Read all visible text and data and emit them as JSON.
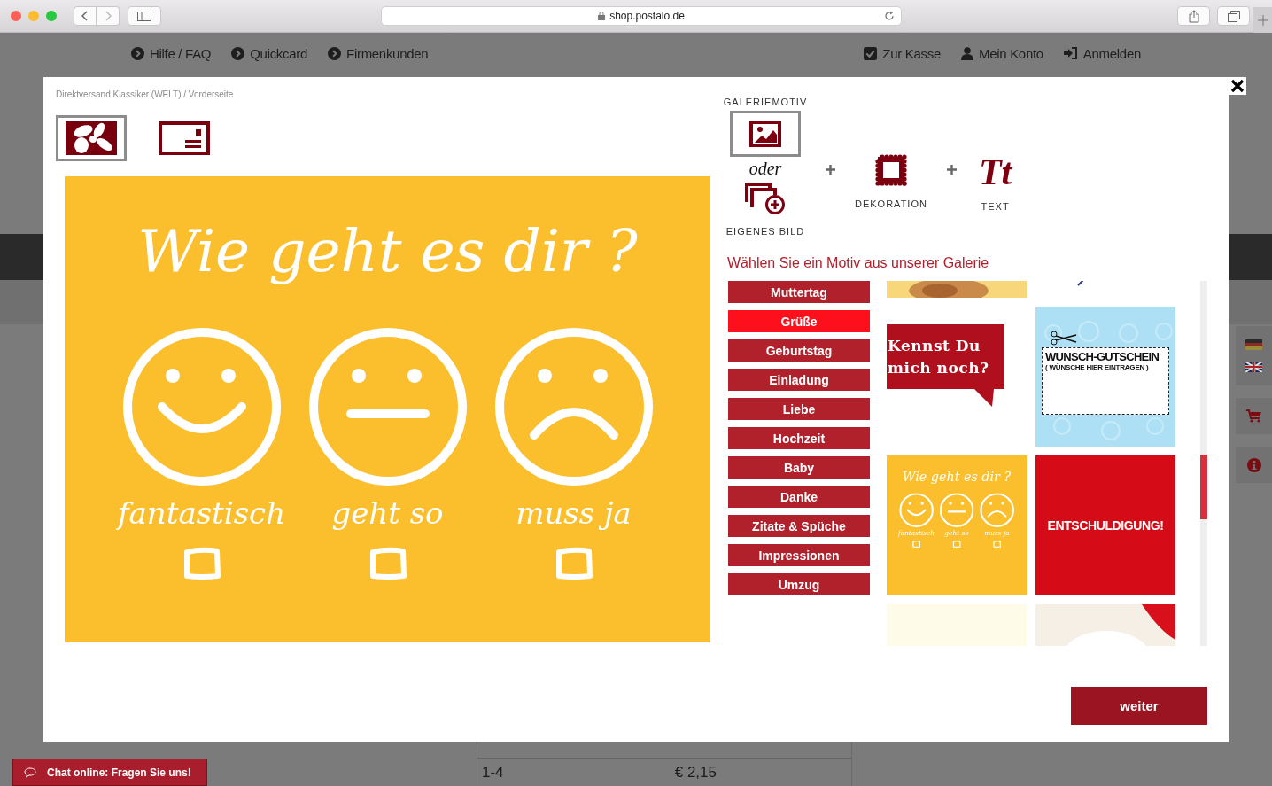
{
  "browser": {
    "url": "shop.postalo.de"
  },
  "top_nav": {
    "left": [
      {
        "label": "Hilfe / FAQ"
      },
      {
        "label": "Quickcard"
      },
      {
        "label": "Firmenkunden"
      }
    ],
    "right": [
      {
        "label": "Zur Kasse",
        "kind": "checkout"
      },
      {
        "label": "Mein Konto",
        "kind": "account"
      },
      {
        "label": "Anmelden",
        "kind": "login"
      }
    ]
  },
  "modal": {
    "breadcrumb": "Direktversand Klassiker (WELT) / Vorderseite",
    "views": [
      {
        "kind": "front",
        "selected": true
      },
      {
        "kind": "back",
        "selected": false
      }
    ],
    "card": {
      "title": "Wie geht es dir ?",
      "options": [
        {
          "label": "fantastisch",
          "kind": "happy"
        },
        {
          "label": "geht so",
          "kind": "neutral"
        },
        {
          "label": "muss ja",
          "kind": "sad"
        }
      ]
    },
    "steps": [
      {
        "label": "GALERIEMOTIV",
        "selected": true
      },
      {
        "label": "EIGENES BILD",
        "selected": false
      },
      {
        "label": "DEKORATION",
        "selected": false
      },
      {
        "label": "TEXT",
        "glyph": "Tt",
        "selected": false
      }
    ],
    "or_label": "oder",
    "gallery_heading": "Wählen Sie ein Motiv aus unserer Galerie",
    "categories": [
      {
        "label": "Muttertag",
        "selected": false
      },
      {
        "label": "Grüße",
        "selected": true
      },
      {
        "label": "Geburtstag",
        "selected": false
      },
      {
        "label": "Einladung",
        "selected": false
      },
      {
        "label": "Liebe",
        "selected": false
      },
      {
        "label": "Hochzeit",
        "selected": false
      },
      {
        "label": "Baby",
        "selected": false
      },
      {
        "label": "Danke",
        "selected": false
      },
      {
        "label": "Zitate & Spüche",
        "selected": false
      },
      {
        "label": "Impressionen",
        "selected": false
      },
      {
        "label": "Umzug",
        "selected": false
      }
    ],
    "gallery": [
      {
        "kind": "picture"
      },
      {
        "kind": "doodle"
      },
      {
        "kind": "speech",
        "lines": [
          "Kennst Du",
          "mich noch?"
        ]
      },
      {
        "kind": "voucher",
        "title": "WUNSCH-GUTSCHEIN",
        "subtitle": "( WÜNSCHE HIER EINTRAGEN )"
      },
      {
        "kind": "mood",
        "title": "Wie geht es dir ?",
        "options": [
          {
            "label": "fantastisch",
            "kind": "happy"
          },
          {
            "label": "geht so",
            "kind": "neutral"
          },
          {
            "label": "muss ja",
            "kind": "sad"
          }
        ]
      },
      {
        "kind": "banner",
        "title": "ENTSCHULDIGUNG!"
      },
      {
        "kind": "blank"
      },
      {
        "kind": "picture"
      }
    ],
    "next_button": "weiter"
  },
  "chat_button": "Chat online: Fragen Sie uns!",
  "price_table": {
    "rows": [
      [
        "1-4",
        "€ 2,15"
      ]
    ]
  }
}
